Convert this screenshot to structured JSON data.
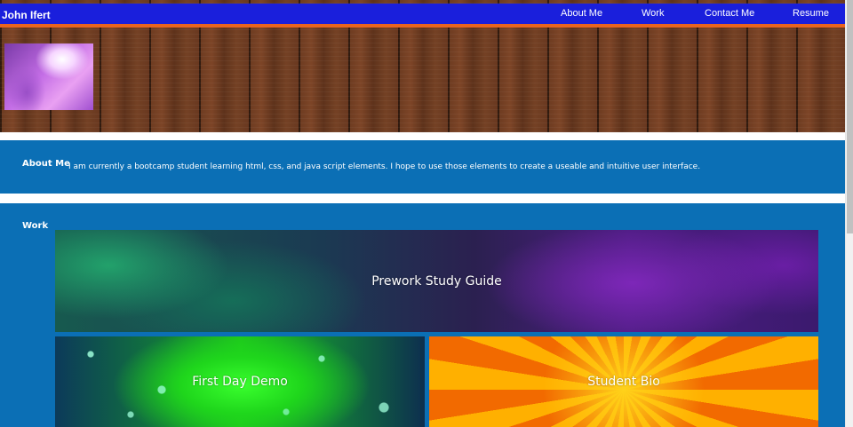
{
  "nav": {
    "brand": "John Ifert",
    "links": [
      "About Me",
      "Work",
      "Contact Me",
      "Resume"
    ]
  },
  "about": {
    "title": "About Me",
    "text": "I am currently a bootcamp student learning html, css, and java script elements. I hope to use those elements to create a useable and intuitive user interface."
  },
  "work": {
    "title": "Work",
    "cards": [
      "Prework Study Guide",
      "First Day Demo",
      "Student Bio"
    ]
  },
  "colors": {
    "nav_bg": "#1a1fdc",
    "nav_accent": "#e9641f",
    "section_bg": "#0b6fb5"
  },
  "icons": {
    "profile": "profile-photo"
  }
}
